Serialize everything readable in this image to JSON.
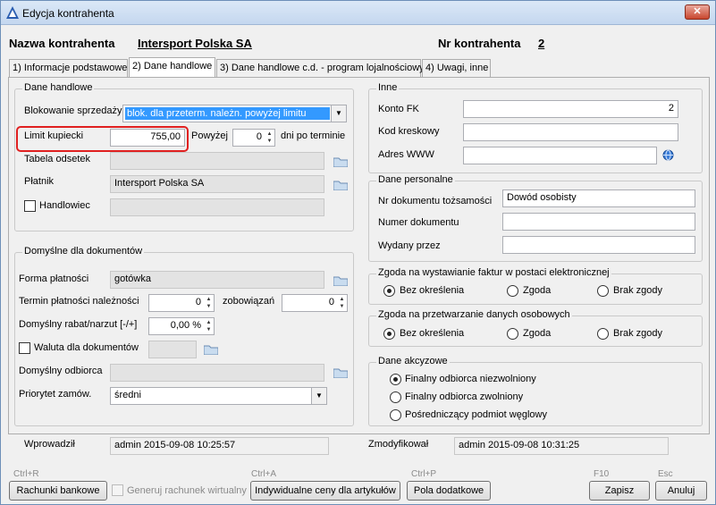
{
  "window": {
    "title": "Edycja kontrahenta",
    "close": "✕"
  },
  "header": {
    "name_label": "Nazwa kontrahenta",
    "name_value": "Intersport Polska SA",
    "nr_label": "Nr kontrahenta",
    "nr_value": "2"
  },
  "tabs": [
    {
      "label": "1) Informacje podstawowe",
      "active": false
    },
    {
      "label": "2) Dane handlowe",
      "active": true
    },
    {
      "label": "3) Dane handlowe c.d. - program lojalnościowy",
      "active": false
    },
    {
      "label": "4) Uwagi, inne",
      "active": false
    }
  ],
  "dane_handlowe": {
    "caption": "Dane handlowe",
    "blokowanie_label": "Blokowanie sprzedaży",
    "blokowanie_value": "blok. dla przeterm. należn. powyżej limitu",
    "limit_label": "Limit kupiecki",
    "limit_value": "755,00",
    "powyzej_label": "Powyżej",
    "powyzej_value": "0",
    "dni_label": "dni po terminie",
    "tabela_label": "Tabela odsetek",
    "tabela_value": "",
    "platnik_label": "Płatnik",
    "platnik_value": "Intersport Polska SA",
    "handlowiec_label": "Handlowiec",
    "handlowiec_value": ""
  },
  "domyslne": {
    "caption": "Domyślne dla dokumentów",
    "forma_label": "Forma płatności",
    "forma_value": "gotówka",
    "termin_label": "Termin płatności należności",
    "termin_value": "0",
    "zobowiazan_label": "zobowiązań",
    "zobowiazan_value": "0",
    "rabat_label": "Domyślny rabat/narzut [-/+]",
    "rabat_value": "0,00 %",
    "waluta_label": "Waluta dla dokumentów",
    "waluta_value": "",
    "odbiorca_label": "Domyślny odbiorca",
    "odbiorca_value": "",
    "priorytet_label": "Priorytet zamów.",
    "priorytet_value": "średni"
  },
  "inne": {
    "caption": "Inne",
    "konto_label": "Konto FK",
    "konto_value": "2",
    "kod_label": "Kod kreskowy",
    "kod_value": "",
    "www_label": "Adres WWW",
    "www_value": ""
  },
  "dane_personalne": {
    "caption": "Dane personalne",
    "nr_dok_label": "Nr dokumentu tożsamości",
    "nr_dok_value": "Dowód osobisty",
    "numer_label": "Numer dokumentu",
    "numer_value": "",
    "wydany_label": "Wydany przez",
    "wydany_value": ""
  },
  "zgoda_faktury": {
    "caption": "Zgoda na wystawianie faktur w postaci elektronicznej",
    "options": [
      "Bez określenia",
      "Zgoda",
      "Brak zgody"
    ]
  },
  "zgoda_dane": {
    "caption": "Zgoda na przetwarzanie danych osobowych",
    "options": [
      "Bez określenia",
      "Zgoda",
      "Brak zgody"
    ]
  },
  "dane_akcyzowe": {
    "caption": "Dane akcyzowe",
    "options": [
      "Finalny odbiorca niezwolniony",
      "Finalny odbiorca zwolniony",
      "Pośredniczący podmiot węglowy"
    ]
  },
  "audit": {
    "wprowadzil_label": "Wprowadził",
    "wprowadzil_value": "admin 2015-09-08 10:25:57",
    "zmodyfikowal_label": "Zmodyfikował",
    "zmodyfikowal_value": "admin 2015-09-08 10:31:25"
  },
  "footer": {
    "rachunki_shortcut": "Ctrl+R",
    "rachunki_label": "Rachunki bankowe",
    "generuj_label": "Generuj rachunek wirtualny",
    "ceny_shortcut": "Ctrl+A",
    "ceny_label": "Indywidualne ceny dla artykułów",
    "pola_shortcut": "Ctrl+P",
    "pola_label": "Pola dodatkowe",
    "zapisz_shortcut": "F10",
    "zapisz_label": "Zapisz",
    "anuluj_shortcut": "Esc",
    "anuluj_label": "Anuluj"
  },
  "colors": {
    "selection": "#3399ff",
    "highlight_border": "#e02020",
    "title_bg": "#c4d7ef"
  }
}
